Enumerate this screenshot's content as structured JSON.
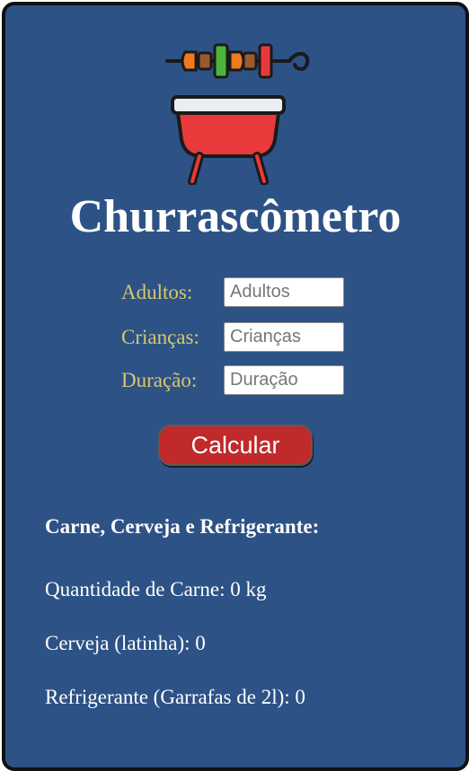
{
  "app": {
    "title": "Churrascômetro"
  },
  "form": {
    "adults": {
      "label": "Adultos:",
      "placeholder": "Adultos",
      "value": ""
    },
    "children": {
      "label": "Crianças:",
      "placeholder": "Crianças",
      "value": ""
    },
    "duration": {
      "label": "Duração:",
      "placeholder": "Duração",
      "value": ""
    },
    "submit_label": "Calcular"
  },
  "results": {
    "heading": "Carne, Cerveja e Refrigerante:",
    "meat": "Quantidade de Carne: 0 kg",
    "beer": "Cerveja (latinha): 0",
    "soda": "Refrigerante (Garrafas de 2l): 0"
  },
  "icons": {
    "logo": "barbecue-grill-icon",
    "skewer": "kebab-skewer-icon"
  },
  "colors": {
    "background": "#2d5286",
    "label_color": "#d9c86a",
    "button": "#c02a2a",
    "grill_red": "#e83a3a",
    "text": "#ffffff"
  }
}
